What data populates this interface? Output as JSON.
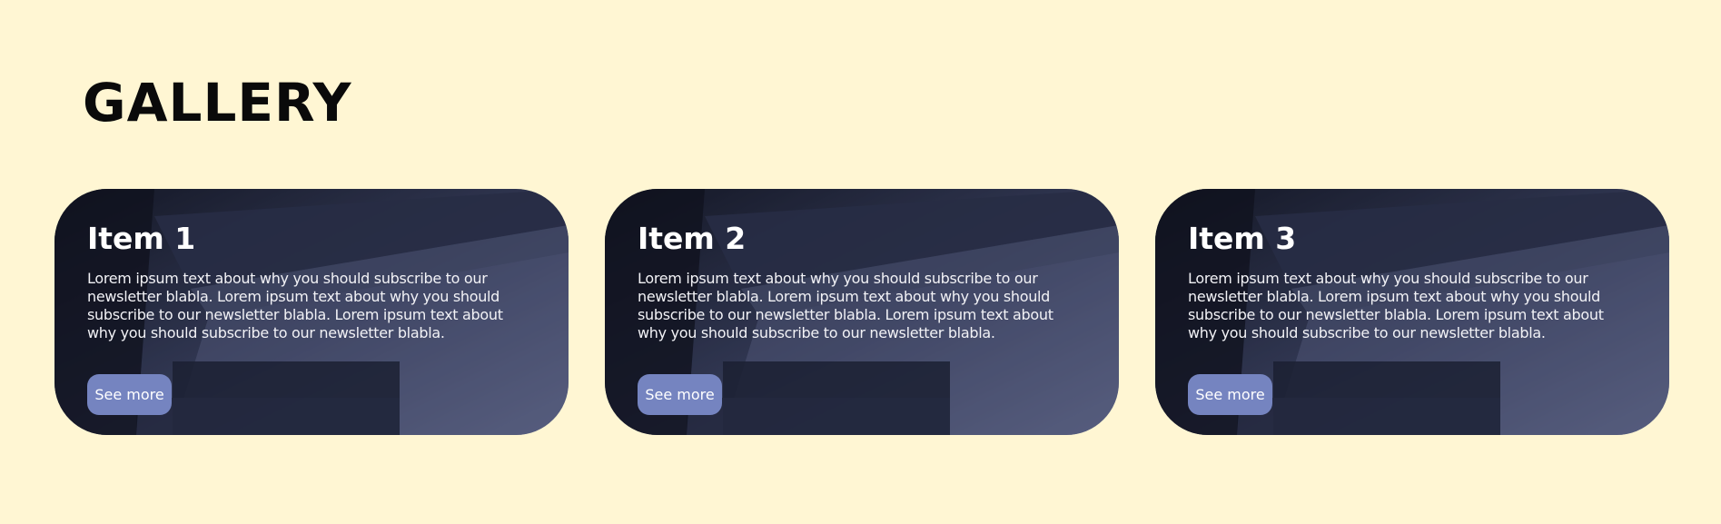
{
  "page": {
    "title": "GALLERY"
  },
  "gallery": {
    "items": [
      {
        "title": "Item 1",
        "text": "Lorem ipsum text about why you should subscribe to our newsletter blabla. Lorem ipsum text about why you should subscribe to our newsletter blabla. Lorem ipsum text about why you should subscribe to our newsletter blabla.",
        "button_label": "See more"
      },
      {
        "title": "Item 2",
        "text": "Lorem ipsum text about why you should subscribe to our newsletter blabla. Lorem ipsum text about why you should subscribe to our newsletter blabla. Lorem ipsum text about why you should subscribe to our newsletter blabla.",
        "button_label": "See more"
      },
      {
        "title": "Item 3",
        "text": "Lorem ipsum text about why you should subscribe to our newsletter blabla. Lorem ipsum text about why you should subscribe to our newsletter blabla. Lorem ipsum text about why you should subscribe to our newsletter blabla.",
        "button_label": "See more"
      }
    ]
  },
  "colors": {
    "background": "#fff6d3",
    "button": "#7584c0",
    "card_overlay": "#1e2238"
  }
}
